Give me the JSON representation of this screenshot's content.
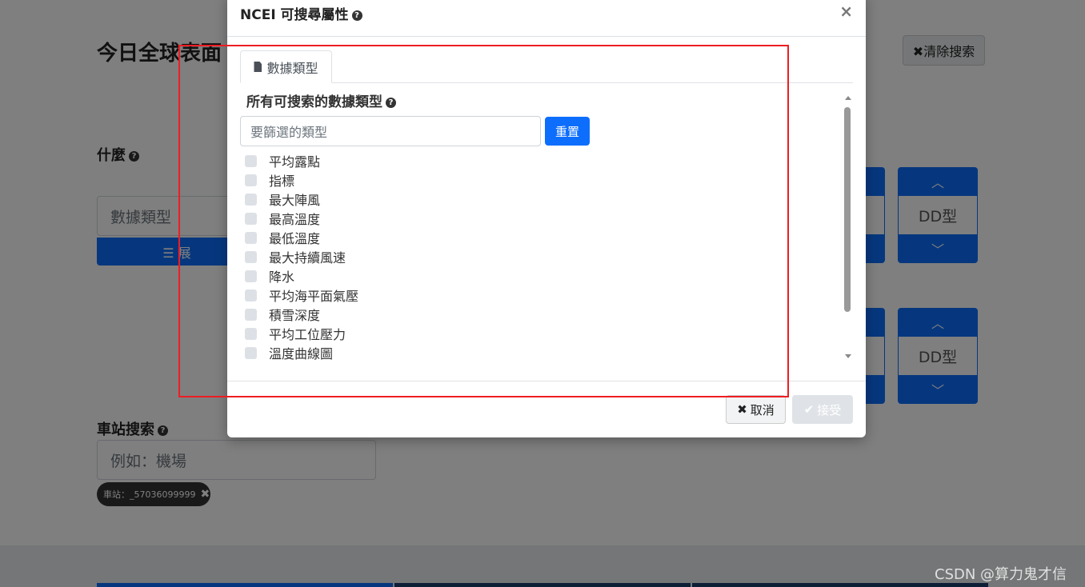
{
  "background": {
    "page_title": "今日全球表面",
    "clear_search": "✖清除搜索",
    "what_label": "什麼",
    "data_type_input": "數據類型",
    "expand_button": "☰ 展",
    "spinner_value": "DD型",
    "station_search_label": "車站搜索",
    "station_placeholder": "例如：機場",
    "station_chip": "車站：_57036099999",
    "watermark": "CSDN @算力鬼才信"
  },
  "modal": {
    "title": "NCEI 可搜尋屬性",
    "close": "×",
    "tab_label": "數據類型",
    "list_heading": "所有可搜索的數據類型",
    "filter_placeholder": "要篩選的類型",
    "reset_label": "重置",
    "types": [
      "平均露點",
      "指標",
      "最大陣風",
      "最高溫度",
      "最低溫度",
      "最大持續風速",
      "降水",
      "平均海平面氣壓",
      "積雪深度",
      "平均工位壓力",
      "溫度曲線圖"
    ],
    "cancel_label": "取消",
    "accept_label": "接受"
  },
  "colors": {
    "primary": "#0d6efd",
    "highlight": "#ee1d23",
    "backdrop": "rgba(0,0,0,0.5)"
  }
}
